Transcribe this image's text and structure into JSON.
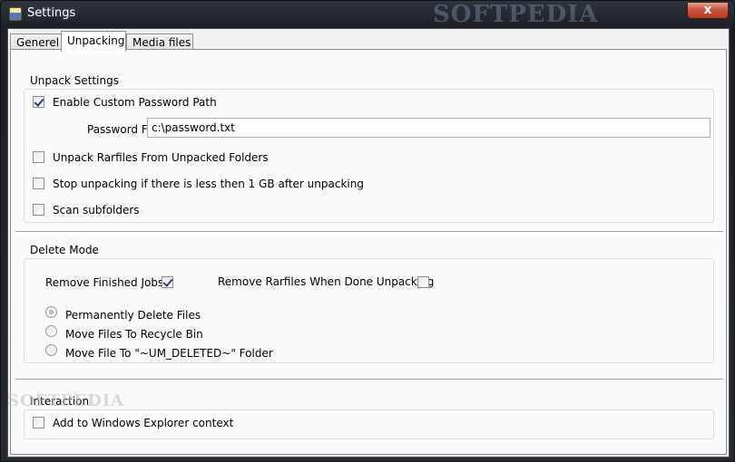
{
  "window": {
    "title": "Settings",
    "close_symbol": "x",
    "watermark": "SOFTPEDIA"
  },
  "tabs": [
    {
      "label": "Generel",
      "active": false
    },
    {
      "label": "Unpacking",
      "active": true
    },
    {
      "label": "Media files",
      "active": false
    }
  ],
  "unpack": {
    "group_title": "Unpack Settings",
    "enable_custom_password_path": {
      "label": "Enable Custom Password Path",
      "checked": true
    },
    "password_file": {
      "label": "Password File:",
      "value": "c:\\password.txt"
    },
    "unpack_rarfiles_from_unpacked": {
      "label": "Unpack Rarfiles From Unpacked Folders",
      "checked": false
    },
    "stop_unpacking_low_space": {
      "label": "Stop unpacking if there is less then 1 GB after unpacking",
      "checked": false
    },
    "scan_subfolders": {
      "label": "Scan subfolders",
      "checked": false
    }
  },
  "delete_mode": {
    "group_title": "Delete Mode",
    "remove_finished_jobs": {
      "label": "Remove Finished Jobs",
      "checked": true
    },
    "remove_rarfiles_when_done": {
      "label": "Remove Rarfiles When Done Unpacking",
      "checked": false
    },
    "options": [
      {
        "label": "Permanently Delete Files",
        "selected": true
      },
      {
        "label": "Move Files To Recycle Bin",
        "selected": false
      },
      {
        "label": "Move File To \"~UM_DELETED~\" Folder",
        "selected": false
      }
    ]
  },
  "interaction": {
    "group_title": "Interaction",
    "add_to_explorer_context": {
      "label": "Add to Windows Explorer context",
      "checked": false
    }
  },
  "watermark_mid": "SOFTPEDIA"
}
